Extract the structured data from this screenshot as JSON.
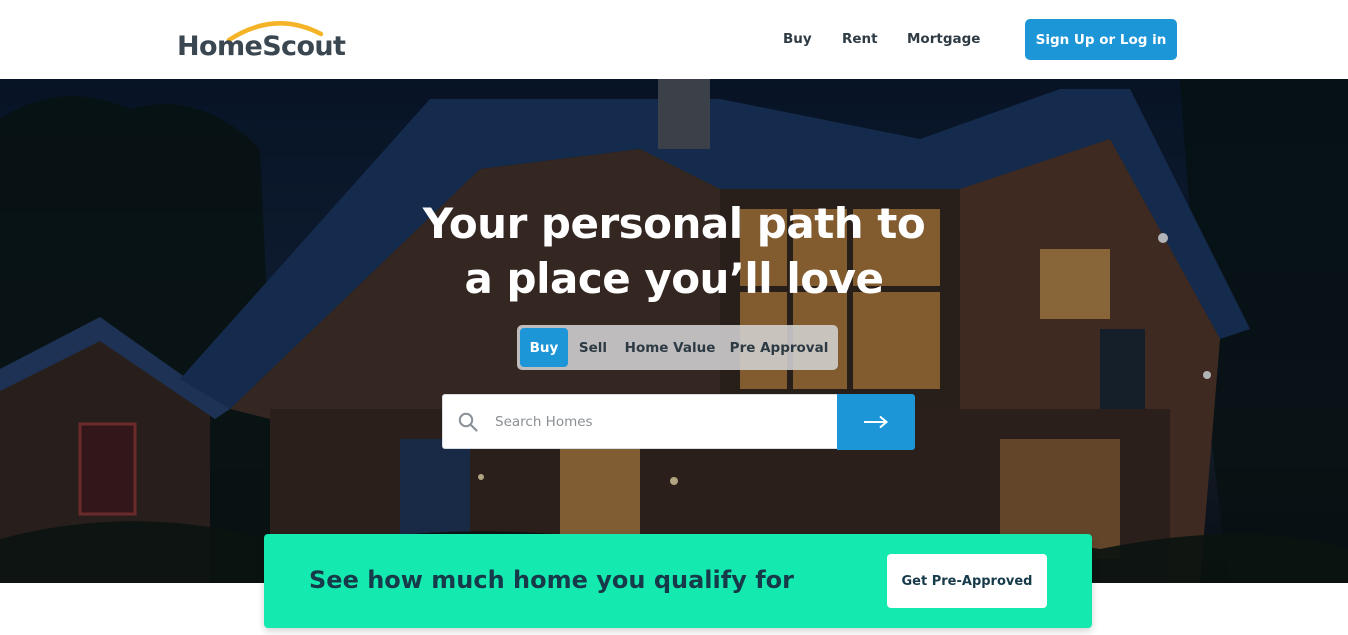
{
  "header": {
    "logo_text": "HomeScout",
    "nav": {
      "buy": "Buy",
      "rent": "Rent",
      "mortgage": "Mortgage"
    },
    "signup_label": "Sign Up or Log in"
  },
  "hero": {
    "title_line1": "Your personal path to",
    "title_line2": "a place you’ll love",
    "tabs": {
      "buy": "Buy",
      "sell": "Sell",
      "home_value": "Home Value",
      "pre_approval": "Pre Approval"
    },
    "active_tab": "Buy",
    "search": {
      "placeholder": "Search Homes",
      "value": ""
    }
  },
  "promo": {
    "text": "See how much home you qualify for",
    "button_label": "Get Pre-Approved"
  },
  "icons": {
    "search": "search-icon",
    "submit": "arrow-right-icon",
    "logo_mark": "heart-icon"
  },
  "colors": {
    "accent": "#1c96d7",
    "promo_bg": "#14eab0",
    "logo_arc": "#f5b428",
    "text_dark": "#173a4a"
  }
}
